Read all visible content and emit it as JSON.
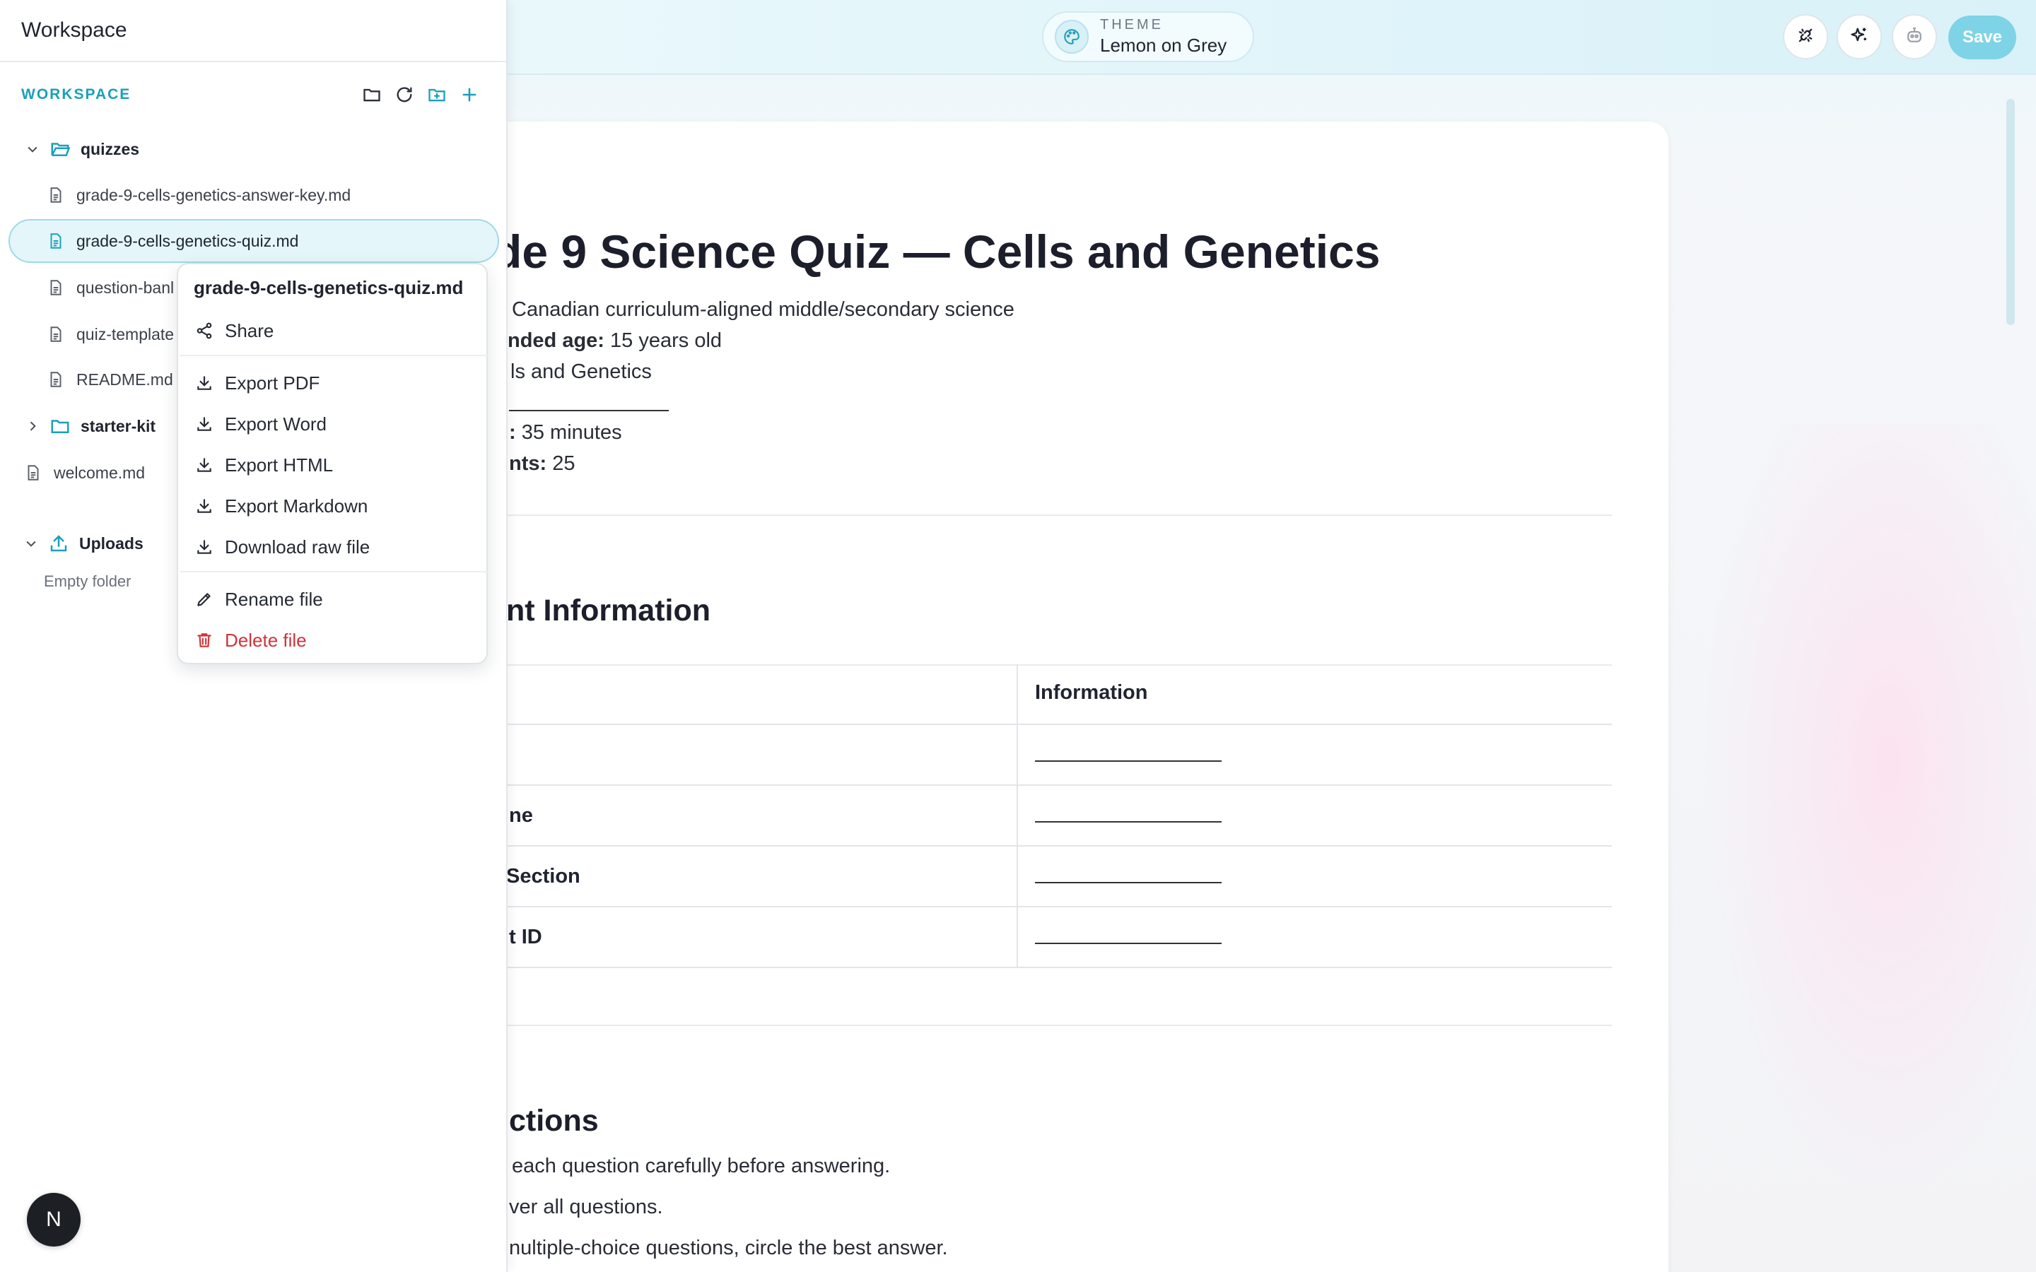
{
  "sidebar": {
    "title": "Workspace",
    "section_label": "WORKSPACE",
    "tree": {
      "quizzes_folder": "quizzes",
      "files": [
        "grade-9-cells-genetics-answer-key.md",
        "grade-9-cells-genetics-quiz.md",
        "question-banl",
        "quiz-template",
        "README.md"
      ],
      "starter_kit_folder": "starter-kit",
      "welcome_file": "welcome.md",
      "uploads_folder": "Uploads",
      "uploads_empty": "Empty folder"
    },
    "avatar_letter": "N"
  },
  "context_menu": {
    "title": "grade-9-cells-genetics-quiz.md",
    "share": "Share",
    "export_pdf": "Export PDF",
    "export_word": "Export Word",
    "export_html": "Export HTML",
    "export_markdown": "Export Markdown",
    "download_raw": "Download raw file",
    "rename": "Rename file",
    "delete": "Delete file"
  },
  "header": {
    "theme_caption": "THEME",
    "theme_value": "Lemon on Grey",
    "save_label": "Save"
  },
  "document": {
    "title": "de 9 Science Quiz — Cells and Genetics",
    "meta_line1": "Canadian curriculum-aligned middle/secondary science",
    "meta_line2_label": "nded age:",
    "meta_line2_value": "15 years old",
    "meta_line3": "ls and Genetics",
    "meta_line4_label": ":",
    "meta_line4_value": "35 minutes",
    "meta_line5_label": "nts:",
    "meta_line5_value": "25",
    "section1": "nt Information",
    "table": {
      "header_right": "Information",
      "rows": [
        "",
        "ne",
        "Section",
        "t ID"
      ]
    },
    "section2": "ctions",
    "instructions": [
      "each question carefully before answering.",
      "ver all questions.",
      "nultiple-choice questions, circle the best answer."
    ]
  },
  "colors": {
    "accent": "#1aa0bb",
    "save_button": "#7fd3e6",
    "danger": "#d0343a"
  }
}
